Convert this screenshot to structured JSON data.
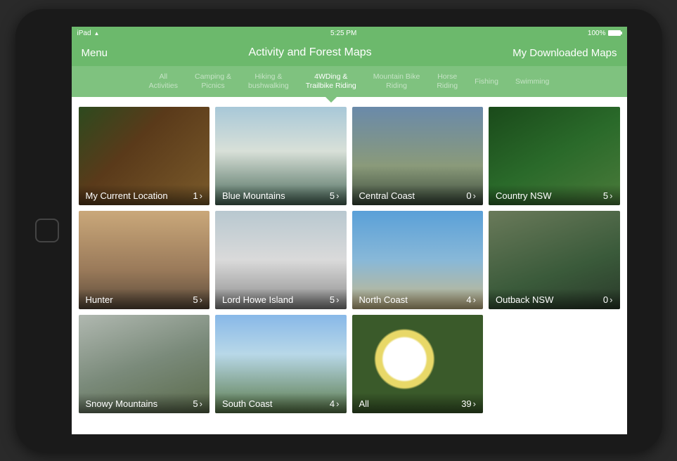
{
  "status": {
    "carrier": "iPad",
    "time": "5:25 PM",
    "battery": "100%"
  },
  "nav": {
    "menu": "Menu",
    "title": "Activity and Forest Maps",
    "downloads": "My Downloaded Maps"
  },
  "tabs": [
    {
      "line1": "All",
      "line2": "Activities",
      "active": false
    },
    {
      "line1": "Camping &",
      "line2": "Picnics",
      "active": false
    },
    {
      "line1": "Hiking &",
      "line2": "bushwalking",
      "active": false
    },
    {
      "line1": "4WDing &",
      "line2": "Trailbike Riding",
      "active": true
    },
    {
      "line1": "Mountain Bike",
      "line2": "Riding",
      "active": false
    },
    {
      "line1": "Horse",
      "line2": "Riding",
      "active": false
    },
    {
      "line1": "Fishing",
      "line2": "",
      "active": false
    },
    {
      "line1": "Swimming",
      "line2": "",
      "active": false
    }
  ],
  "cards": [
    {
      "title": "My Current Location",
      "count": "1"
    },
    {
      "title": "Blue Mountains",
      "count": "5"
    },
    {
      "title": "Central Coast",
      "count": "0"
    },
    {
      "title": "Country NSW",
      "count": "5"
    },
    {
      "title": "Hunter",
      "count": "5"
    },
    {
      "title": "Lord Howe Island",
      "count": "5"
    },
    {
      "title": "North Coast",
      "count": "4"
    },
    {
      "title": "Outback NSW",
      "count": "0"
    },
    {
      "title": "Snowy Mountains",
      "count": "5"
    },
    {
      "title": "South Coast",
      "count": "4"
    },
    {
      "title": "All",
      "count": "39"
    }
  ]
}
